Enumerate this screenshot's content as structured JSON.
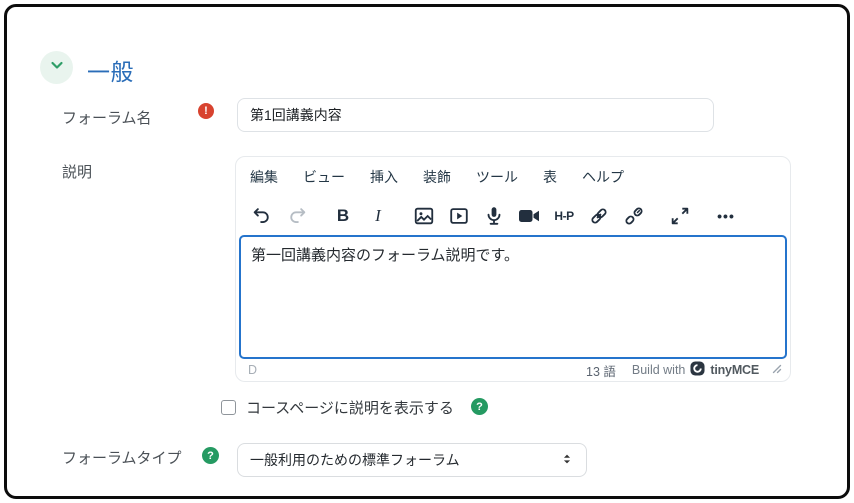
{
  "section": {
    "title": "一般"
  },
  "forum_name_row": {
    "label": "フォーラム名",
    "value": "第1回講義内容",
    "required_mark": "!"
  },
  "description_row": {
    "label": "説明",
    "editor": {
      "menu_items": [
        "編集",
        "ビュー",
        "挿入",
        "装飾",
        "ツール",
        "表",
        "ヘルプ"
      ],
      "toolbar_icons": [
        "undo",
        "redo",
        "bold",
        "italic",
        "image",
        "media",
        "record-audio",
        "record-video",
        "h5p",
        "link",
        "unlink",
        "fullscreen",
        "more"
      ],
      "bold_label": "B",
      "italic_label": "I",
      "h5p_label": "H-P",
      "more_label": "•••",
      "content_text": "第一回講義内容のフォーラム説明です。",
      "statusbar": {
        "element_path": "D",
        "word_count": "13 語",
        "branding_prefix": "Build with",
        "branding_name": "tinyMCE"
      }
    }
  },
  "show_description_row": {
    "label": "コースページに説明を表示する",
    "checked": false,
    "help_mark": "?"
  },
  "forum_type_row": {
    "label": "フォーラムタイプ",
    "selected_option": "一般利用のための標準フォーラム",
    "help_mark": "?"
  },
  "colors": {
    "accent_blue": "#2a6db8",
    "focus_border": "#2574cc",
    "required_red": "#d8432f",
    "help_green": "#259a62",
    "chevron_green": "#2f9e68"
  }
}
